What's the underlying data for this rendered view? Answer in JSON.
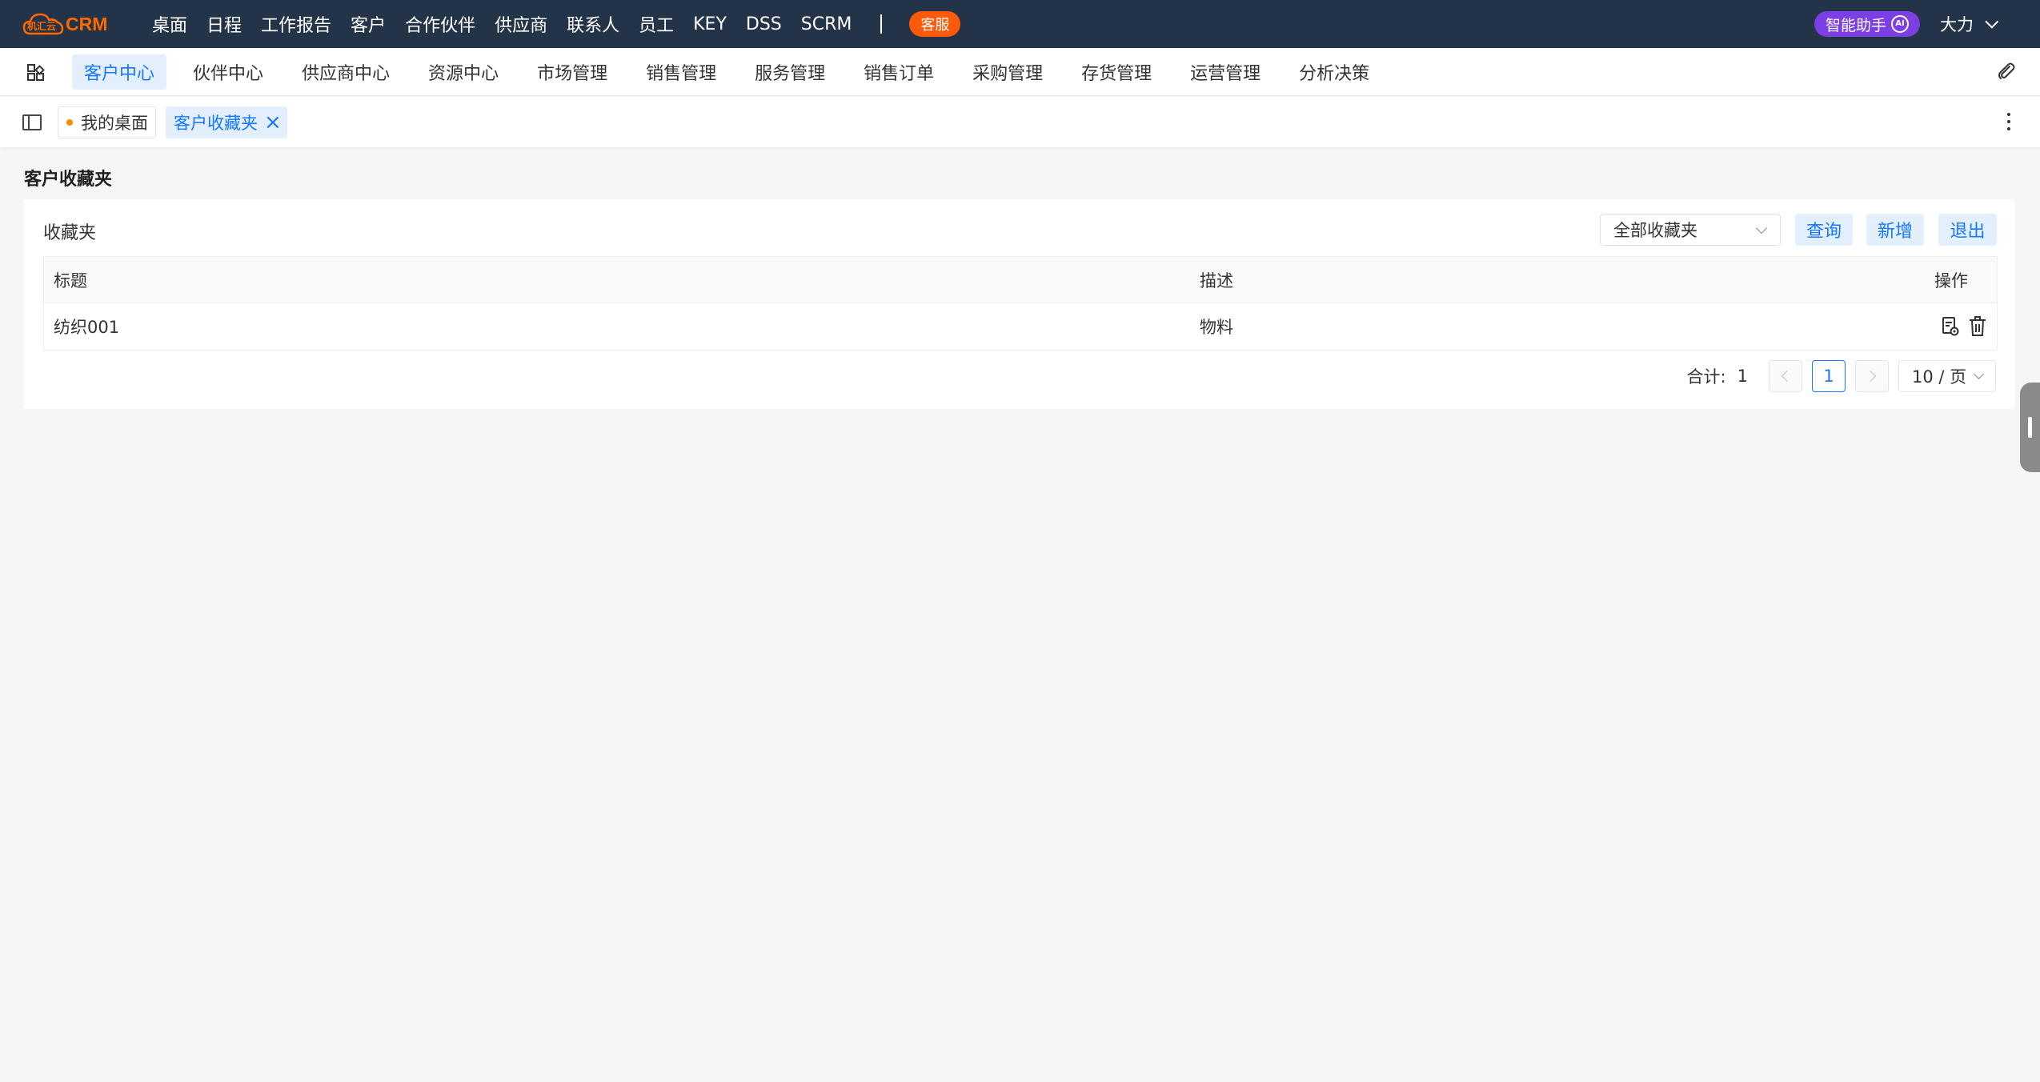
{
  "brand": {
    "logo_text": "机汇云",
    "product": "CRM",
    "accent_color": "#ff6a00"
  },
  "top_nav": {
    "items": [
      "桌面",
      "日程",
      "工作报告",
      "客户",
      "合作伙伴",
      "供应商",
      "联系人",
      "员工",
      "KEY",
      "DSS",
      "SCRM"
    ],
    "service_label": "客服",
    "ai_label": "智能助手",
    "ai_badge": "AI",
    "user_name": "大力"
  },
  "menu": {
    "items": [
      "客户中心",
      "伙伴中心",
      "供应商中心",
      "资源中心",
      "市场管理",
      "销售管理",
      "服务管理",
      "销售订单",
      "采购管理",
      "存货管理",
      "运营管理",
      "分析决策"
    ],
    "active_index": 0,
    "active_color": "#1677ff"
  },
  "tabs": {
    "home_label": "我的桌面",
    "current_label": "客户收藏夹"
  },
  "page": {
    "title": "客户收藏夹",
    "favorites_label": "收藏夹",
    "select_value": "全部收藏夹",
    "query_button": "查询",
    "add_button": "新增",
    "exit_button": "退出"
  },
  "table": {
    "columns": [
      "标题",
      "描述",
      "操作"
    ],
    "rows": [
      {
        "title": "纺织001",
        "description": "物料"
      }
    ]
  },
  "pagination": {
    "total_label": "合计:",
    "total": "1",
    "current_page": "1",
    "page_size": "10 / 页"
  }
}
